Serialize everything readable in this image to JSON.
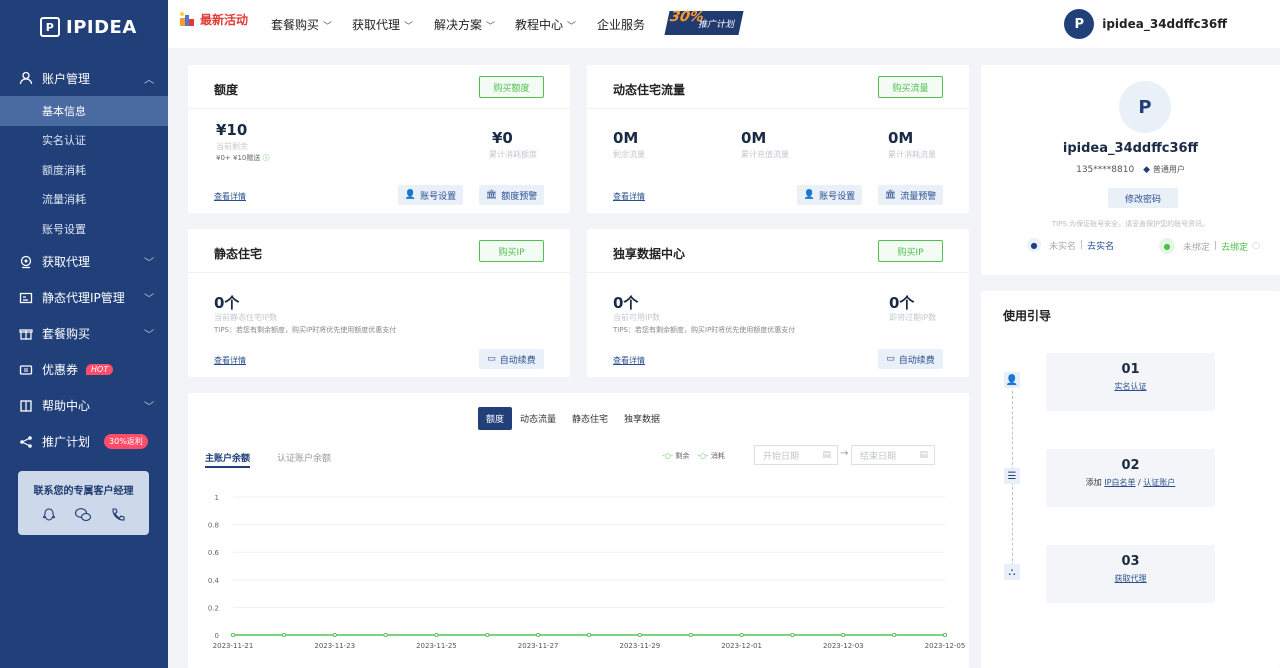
{
  "brand": "IPIDEA",
  "sidebar": {
    "groups": [
      {
        "label": "账户管理",
        "items": [
          "基本信息",
          "实名认证",
          "额度消耗",
          "流量消耗",
          "账号设置"
        ]
      },
      {
        "label": "获取代理"
      },
      {
        "label": "静态代理IP管理"
      },
      {
        "label": "套餐购买"
      },
      {
        "label": "优惠券",
        "badge": "HOT"
      },
      {
        "label": "帮助中心"
      },
      {
        "label": "推广计划",
        "badge": "30%返利"
      }
    ],
    "manager_title": "联系您的专属客户经理"
  },
  "topnav": {
    "items": [
      "最新活动",
      "套餐购买",
      "获取代理",
      "解决方案",
      "教程中心",
      "企业服务"
    ],
    "promo_num": "30%",
    "promo_label": "推广计划",
    "username": "ipidea_34ddffc36ff"
  },
  "quota": {
    "title": "额度",
    "buy": "购买额度",
    "remain": "¥10",
    "remain_label": "当前剩余",
    "remain_detail": "¥0+ ¥10赠送",
    "used": "¥0",
    "used_label": "累计消耗额度",
    "detail": "查看详情",
    "btn1": "账号设置",
    "btn2": "额度预警"
  },
  "dyn": {
    "title": "动态住宅流量",
    "buy": "购买流量",
    "v1": "0M",
    "l1": "剩余流量",
    "v2": "0M",
    "l2": "累计充值流量",
    "v3": "0M",
    "l3": "累计消耗流量",
    "detail": "查看详情",
    "btn1": "账号设置",
    "btn2": "流量预警"
  },
  "static": {
    "title": "静态住宅",
    "buy": "购买IP",
    "v1": "0个",
    "l1": "当前静态住宅IP数",
    "tips": "TIPS：若您有剩余额度，购买IP时将优先使用额度优惠支付",
    "detail": "查看详情",
    "btn": "自动续费"
  },
  "dc": {
    "title": "独享数据中心",
    "buy": "购买IP",
    "v1": "0个",
    "l1": "当前可用IP数",
    "v2": "0个",
    "l2": "即将过期IP数",
    "tips": "TIPS：若您有剩余额度，购买IP时将优先使用额度优惠支付",
    "detail": "查看详情",
    "btn": "自动续费"
  },
  "chart_panel": {
    "tabs": [
      "额度",
      "动态流量",
      "静态住宅",
      "独享数据"
    ],
    "acct_tabs": [
      "主账户余额",
      "认证账户余额"
    ],
    "legend": [
      "剩余",
      "消耗"
    ],
    "start_placeholder": "开始日期",
    "end_placeholder": "结束日期"
  },
  "chart_data": {
    "type": "line",
    "x": [
      "2023-11-21",
      "2023-11-22",
      "2023-11-23",
      "2023-11-24",
      "2023-11-25",
      "2023-11-26",
      "2023-11-27",
      "2023-11-28",
      "2023-11-29",
      "2023-11-30",
      "2023-12-01",
      "2023-12-02",
      "2023-12-03",
      "2023-12-04",
      "2023-12-05"
    ],
    "x_tick_labels": [
      "2023-11-21",
      "2023-11-23",
      "2023-11-25",
      "2023-11-27",
      "2023-11-29",
      "2023-12-01",
      "2023-12-03",
      "2023-12-05"
    ],
    "series": [
      {
        "name": "剩余",
        "values": [
          0,
          0,
          0,
          0,
          0,
          0,
          0,
          0,
          0,
          0,
          0,
          0,
          0,
          0,
          0
        ]
      },
      {
        "name": "消耗",
        "values": [
          0,
          0,
          0,
          0,
          0,
          0,
          0,
          0,
          0,
          0,
          0,
          0,
          0,
          0,
          0
        ]
      }
    ],
    "yticks": [
      "0",
      "0.2",
      "0.4",
      "0.6",
      "0.8",
      "1"
    ],
    "ylim": [
      0,
      1
    ],
    "grid": true,
    "colors": {
      "line": "#4fc04f",
      "grid": "#eef0f4"
    }
  },
  "profile": {
    "name": "ipidea_34ddffc36ff",
    "phone": "135****8810",
    "level": "普通用户",
    "change_pwd": "修改密码",
    "tips": "TIPS:为保证账号安全，请妥善保护您的账号资讯。",
    "realname_status": "未实名",
    "realname_link": "去实名",
    "wechat_status": "未绑定",
    "wechat_link": "去绑定"
  },
  "guide": {
    "title": "使用引导",
    "steps": [
      {
        "num": "01",
        "text": "实名认证"
      },
      {
        "num": "02",
        "prefix": "添加",
        "link1": "IP白名单",
        "sep": "/",
        "link2": "认证账户"
      },
      {
        "num": "03",
        "text": "获取代理"
      }
    ]
  },
  "colors": {
    "primary": "#21407a",
    "green": "#4fc04f",
    "hot": "#ff4d6a"
  }
}
